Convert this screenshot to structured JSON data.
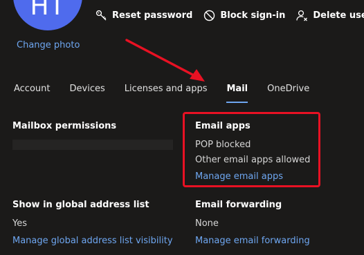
{
  "profile": {
    "initials": "HT",
    "avatar_color": "#4f6bed",
    "change_photo_label": "Change photo"
  },
  "actions": [
    {
      "label": "Reset password",
      "icon": "key-icon"
    },
    {
      "label": "Block sign-in",
      "icon": "block-icon"
    },
    {
      "label": "Delete user",
      "icon": "delete-user-icon"
    }
  ],
  "tabs": [
    {
      "label": "Account",
      "active": false
    },
    {
      "label": "Devices",
      "active": false
    },
    {
      "label": "Licenses and apps",
      "active": false
    },
    {
      "label": "Mail",
      "active": true
    },
    {
      "label": "OneDrive",
      "active": false
    }
  ],
  "mailbox_permissions": {
    "title": "Mailbox permissions"
  },
  "email_apps": {
    "title": "Email apps",
    "pop_status": "POP blocked",
    "other_status": "Other email apps allowed",
    "manage_link": "Manage email apps"
  },
  "global_address_list": {
    "title": "Show in global address list",
    "value": "Yes",
    "manage_link": "Manage global address list visibility"
  },
  "email_forwarding": {
    "title": "Email forwarding",
    "value": "None",
    "manage_link": "Manage email forwarding"
  },
  "colors": {
    "background": "#1b1a19",
    "link": "#6ea6f0",
    "highlight": "#e81123"
  }
}
